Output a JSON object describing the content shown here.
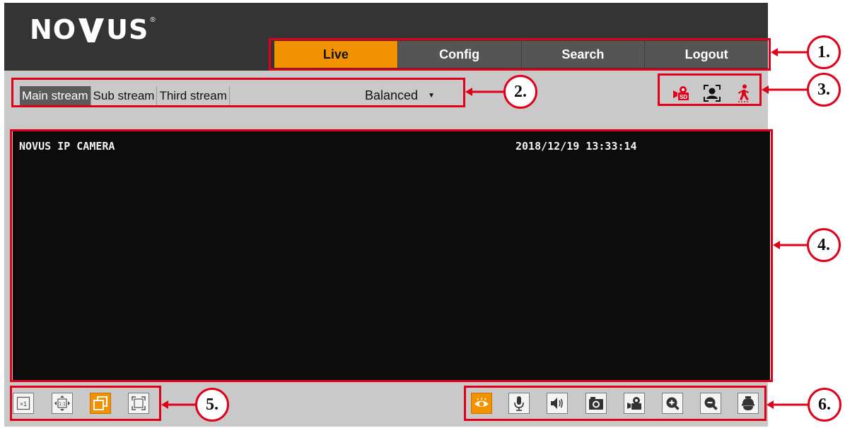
{
  "brand": {
    "logo_text_left": "NO",
    "logo_text_right": "US"
  },
  "nav": {
    "tabs": [
      {
        "label": "Live",
        "active": true
      },
      {
        "label": "Config"
      },
      {
        "label": "Search"
      },
      {
        "label": "Logout"
      }
    ]
  },
  "streams": {
    "items": [
      {
        "label": "Main stream",
        "active": true
      },
      {
        "label": "Sub stream"
      },
      {
        "label": "Third stream"
      }
    ],
    "quality": "Balanced"
  },
  "status_icons": [
    "sd-record-icon",
    "face-detection-icon",
    "motion-detection-icon"
  ],
  "video": {
    "overlay_name": "NOVUS IP CAMERA",
    "overlay_datetime": "2018/12/19 13:33:14"
  },
  "view_controls": [
    "original-size-icon",
    "fit-ratio-icon",
    "window-mode-icon",
    "fullscreen-icon"
  ],
  "live_controls": [
    "live-view-icon",
    "microphone-icon",
    "speaker-icon",
    "snapshot-icon",
    "record-icon",
    "zoom-in-icon",
    "zoom-out-icon",
    "ptz-dome-icon"
  ],
  "callouts": [
    "1.",
    "2.",
    "3.",
    "4.",
    "5.",
    "6."
  ],
  "colors": {
    "accent": "#f39200",
    "header_bg": "#343434",
    "annotation_red": "#e1001a"
  }
}
